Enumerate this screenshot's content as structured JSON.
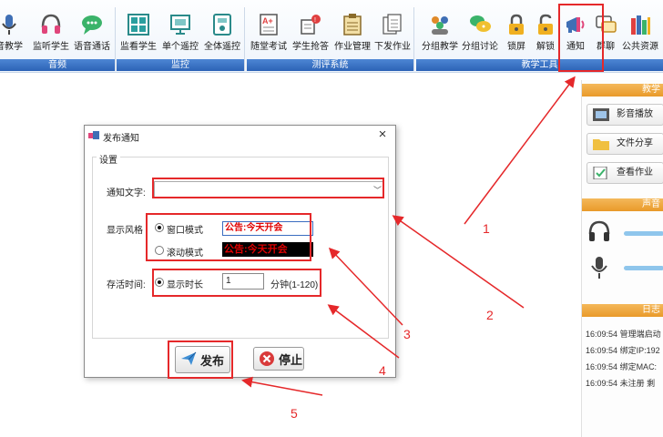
{
  "ribbon": {
    "groups": [
      {
        "label": "音频",
        "buttons": [
          {
            "label": "音教学",
            "icon": "microphone-icon"
          },
          {
            "label": "监听学生",
            "icon": "headset-icon"
          },
          {
            "label": "语音通话",
            "icon": "chat-bubble-icon"
          }
        ]
      },
      {
        "label": "监控",
        "buttons": [
          {
            "label": "监看学生",
            "icon": "monitor-grid-icon"
          },
          {
            "label": "单个遥控",
            "icon": "remote-screen-icon"
          },
          {
            "label": "全体遥控",
            "icon": "remote-all-icon"
          }
        ]
      },
      {
        "label": "测评系统",
        "buttons": [
          {
            "label": "随堂考试",
            "icon": "exam-sheet-icon"
          },
          {
            "label": "学生抢答",
            "icon": "raise-hand-icon"
          },
          {
            "label": "作业管理",
            "icon": "clipboard-icon"
          },
          {
            "label": "下发作业",
            "icon": "documents-icon"
          }
        ]
      },
      {
        "label": "教学工具",
        "buttons": [
          {
            "label": "分组教学",
            "icon": "group-users-icon"
          },
          {
            "label": "分组讨论",
            "icon": "discussion-icon"
          },
          {
            "label": "锁屏",
            "icon": "lock-icon"
          },
          {
            "label": "解锁",
            "icon": "unlock-icon"
          },
          {
            "label": "通知",
            "icon": "megaphone-icon"
          },
          {
            "label": "群聊",
            "icon": "group-chat-icon"
          },
          {
            "label": "公共资源",
            "icon": "books-icon"
          }
        ]
      }
    ]
  },
  "sidepanel": {
    "teaching_header": "教学",
    "buttons": [
      {
        "label": "影音播放",
        "icon": "film-icon"
      },
      {
        "label": "文件分享",
        "icon": "folder-icon"
      },
      {
        "label": "查看作业",
        "icon": "check-clipboard-icon"
      }
    ],
    "sound_header": "声音",
    "log_header": "日志",
    "logs": [
      {
        "time": "16:09:54",
        "text": "管理端启动"
      },
      {
        "time": "16:09:54",
        "text": "绑定IP:192"
      },
      {
        "time": "16:09:54",
        "text": "绑定MAC:"
      },
      {
        "time": "16:09:54",
        "text": "未注册 剩"
      }
    ]
  },
  "dialog": {
    "title": "发布通知",
    "close": "×",
    "settings_legend": "设置",
    "notice_text_label": "通知文字:",
    "notice_text_value": "",
    "display_style_label": "显示风格",
    "window_mode_label": "窗口模式",
    "scroll_mode_label": "滚动模式",
    "preview_text": "公告:今天开会",
    "duration_label": "存活时间:",
    "show_duration_label": "显示时长",
    "duration_value": "1",
    "duration_unit": "分钟(1-120)",
    "publish_label": "发布",
    "stop_label": "停止"
  },
  "annotations": [
    "1",
    "2",
    "3",
    "4",
    "5"
  ],
  "colors": {
    "annotation": "#e5282a",
    "ribbon_label": "#2c63b6",
    "panel_header": "#e99a2a"
  }
}
